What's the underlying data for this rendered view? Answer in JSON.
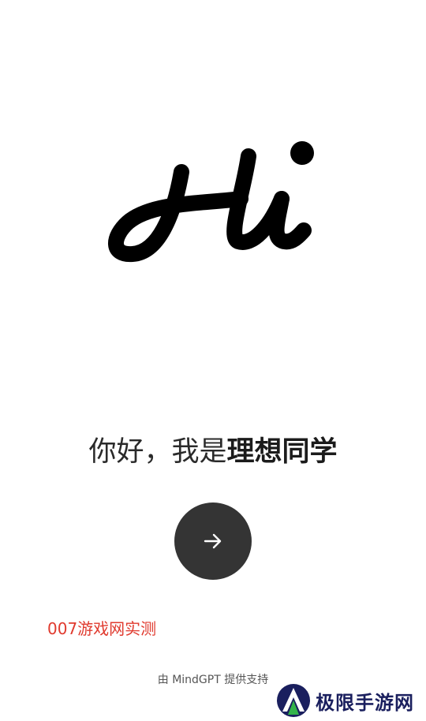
{
  "logo": {
    "text": "Hi",
    "icon": "hi-script-logo-icon"
  },
  "greeting": {
    "prefix": "你好，我是",
    "name": "理想同学"
  },
  "start_button": {
    "icon": "arrow-right-icon",
    "color": "#343434"
  },
  "watermark_top": {
    "text": "007游戏网实测",
    "color": "#e03a2e"
  },
  "footer": {
    "text": "由 MindGPT 提供支持"
  },
  "watermark_bottom": {
    "icon": "jixian-logo-icon",
    "text": "极限手游网"
  }
}
